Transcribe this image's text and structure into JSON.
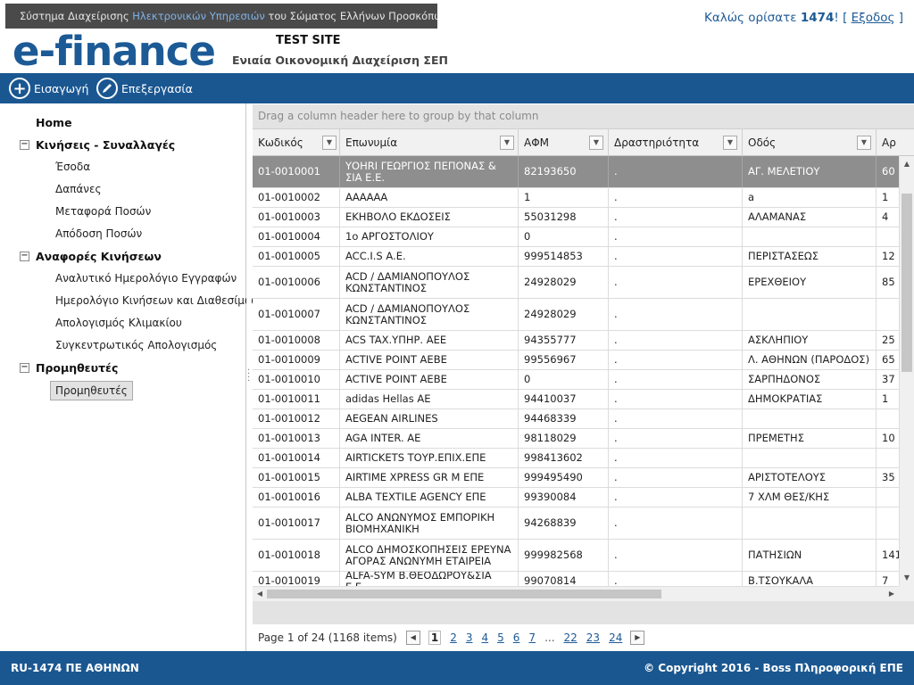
{
  "header": {
    "banner_prefix": "Σύστημα Διαχείρισης ",
    "banner_highlight": "Ηλεκτρονικών Υπηρεσιών",
    "banner_suffix": " του Σώματος Ελλήνων Προσκόπων",
    "logo": "e-finance",
    "test_site": "TEST SITE",
    "subtitle": "Ενιαία Οικονομική Διαχείριση ΣΕΠ",
    "welcome": "Καλώς ορίσατε ",
    "user": "1474",
    "welcome_sep": "! [ ",
    "logout": "Εξοδος",
    "welcome_end": " ]"
  },
  "toolbar": {
    "insert_label": "Εισαγωγή",
    "edit_label": "Επεξεργασία"
  },
  "sidebar": {
    "home": "Home",
    "groups": [
      {
        "label": "Κινήσεις - Συναλλαγές",
        "items": [
          "Έσοδα",
          "Δαπάνες",
          "Μεταφορά Ποσών",
          "Απόδοση Ποσών"
        ]
      },
      {
        "label": "Αναφορές Κινήσεων",
        "items": [
          "Αναλυτικό Ημερολόγιο Εγγραφών",
          "Ημερολόγιο Κινήσεων και Διαθεσίμων",
          "Απολογισμός Κλιμακίου",
          "Συγκεντρωτικός Απολογισμός"
        ]
      },
      {
        "label": "Προμηθευτές",
        "items": []
      }
    ],
    "selected_item": "Προμηθευτές"
  },
  "grid": {
    "group_hint": "Drag a column header here to group by that column",
    "columns": [
      "Κωδικός",
      "Επωνυμία",
      "ΑΦΜ",
      "Δραστηριότητα",
      "Οδός",
      "Αρ"
    ],
    "rows": [
      [
        "01-0010001",
        "ΥΟΗRI ΓΕΩΡΓΙΟΣ ΠΕΠΟΝΑΣ & ΣΙΑ Ε.Ε.",
        "82193650",
        ".",
        "ΑΓ. ΜΕΛΕΤΙΟΥ",
        "60"
      ],
      [
        "01-0010002",
        "ΑΑΑΑΑΑ",
        "1",
        ".",
        "a",
        "1"
      ],
      [
        "01-0010003",
        "ΕΚΗΒΟΛΟ ΕΚΔΟΣΕΙΣ",
        "55031298",
        ".",
        "ΑΛΑΜΑΝΑΣ",
        "4"
      ],
      [
        "01-0010004",
        "1ο ΑΡΓΟΣΤΟΛΙΟΥ",
        "0",
        ".",
        "",
        ""
      ],
      [
        "01-0010005",
        "ACC.I.S A.E.",
        "999514853",
        ".",
        "ΠΕΡΙΣΤΑΣΕΩΣ",
        "12"
      ],
      [
        "01-0010006",
        "ACD / ΔΑΜΙΑΝΟΠΟΥΛΟΣ ΚΩΝΣΤΑΝΤΙΝΟΣ",
        "24928029",
        ".",
        "ΕΡΕΧΘΕΙΟΥ",
        "85"
      ],
      [
        "01-0010007",
        "ACD / ΔΑΜΙΑΝΟΠΟΥΛΟΣ ΚΩΝΣΤΑΝΤΙΝΟΣ",
        "24928029",
        ".",
        "",
        ""
      ],
      [
        "01-0010008",
        "ACS TAX.ΥΠΗΡ. ΑΕΕ",
        "94355777",
        ".",
        "ΑΣΚΛΗΠΙΟΥ",
        "25"
      ],
      [
        "01-0010009",
        "ACTIVE POINT ΑΕΒΕ",
        "99556967",
        ".",
        "Λ. ΑΘΗΝΩΝ (ΠΑΡΟΔΟΣ)",
        "65"
      ],
      [
        "01-0010010",
        "ACTIVE POINT ΑΕΒΕ",
        "0",
        ".",
        "ΣΑΡΠΗΔΟΝΟΣ",
        "37"
      ],
      [
        "01-0010011",
        "adidas Hellas AE",
        "94410037",
        ".",
        "ΔΗΜΟΚΡΑΤΙΑΣ",
        "1"
      ],
      [
        "01-0010012",
        "AEGEAN AIRLINES",
        "94468339",
        ".",
        "",
        ""
      ],
      [
        "01-0010013",
        "AGA INTER. AE",
        "98118029",
        ".",
        "ΠΡΕΜΕΤΗΣ",
        "10"
      ],
      [
        "01-0010014",
        "AIRTICKETS ΤΟΥΡ.ΕΠΙΧ.ΕΠΕ",
        "998413602",
        ".",
        "",
        ""
      ],
      [
        "01-0010015",
        "AIRTIME XPRESS GR M ΕΠΕ",
        "999495490",
        ".",
        "ΑΡΙΣΤΟΤΕΛΟΥΣ",
        "35"
      ],
      [
        "01-0010016",
        "ALBA TEXTILE AGENCY ΕΠΕ",
        "99390084",
        ".",
        "7 ΧΛΜ ΘΕΣ/ΚΗΣ",
        ""
      ],
      [
        "01-0010017",
        "ALCO ΑΝΩΝΥΜΟΣ ΕΜΠΟΡΙΚΗ ΒΙΟΜΗΧΑΝΙΚΗ",
        "94268839",
        ".",
        "",
        ""
      ],
      [
        "01-0010018",
        "ALCO ΔΗΜΟΣΚΟΠΗΣΕΙΣ ΕΡΕΥΝΑ ΑΓΟΡΑΣ ΑΝΩΝΥΜΗ ΕΤΑΙΡΕΙΑ",
        "999982568",
        ".",
        "ΠΑΤΗΣΙΩΝ",
        "141"
      ],
      [
        "01-0010019",
        "ALFA-SYM Β.ΘΕΟΔΩΡΟΥ&ΣΙΑ Ε.Ε.",
        "99070814",
        ".",
        "Β.ΤΣΟΥΚΑΛΑ",
        "7"
      ]
    ],
    "pager_info": "Page 1 of 24 (1168 items)",
    "pages": [
      "1",
      "2",
      "3",
      "4",
      "5",
      "6",
      "7",
      "...",
      "22",
      "23",
      "24"
    ],
    "current_page": "1"
  },
  "footer": {
    "left": "RU-1474 ΠΕ ΑΘΗΝΩΝ",
    "right": "© Copyright 2016 - Boss Πληροφορική ΕΠΕ"
  }
}
